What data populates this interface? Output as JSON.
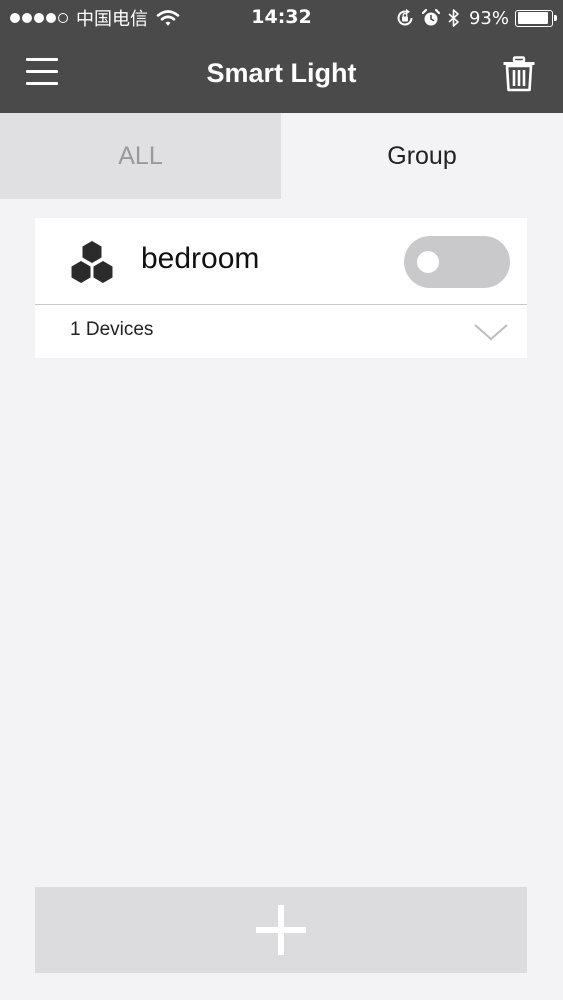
{
  "status_bar": {
    "carrier": "中国电信",
    "time": "14:32",
    "battery_percent": "93%",
    "battery_level": 0.93,
    "signal_bars_filled": 4,
    "signal_bars_total": 5
  },
  "header": {
    "title": "Smart Light",
    "menu_icon": "hamburger-menu-icon",
    "delete_icon": "trash-icon"
  },
  "tabs": [
    {
      "label": "ALL",
      "selected": false
    },
    {
      "label": "Group",
      "selected": true
    }
  ],
  "groups": [
    {
      "name": "bedroom",
      "icon": "hexagon-cluster-icon",
      "device_count_label": "1 Devices",
      "power_on": false
    }
  ],
  "footer": {
    "add_icon": "plus-icon"
  },
  "colors": {
    "bar_background": "#4a4a4a",
    "page_background": "#f3f2f5",
    "inactive_tab": "#e0dfe2",
    "toggle_off": "#c9c8cb",
    "add_button": "#dcdbde"
  }
}
